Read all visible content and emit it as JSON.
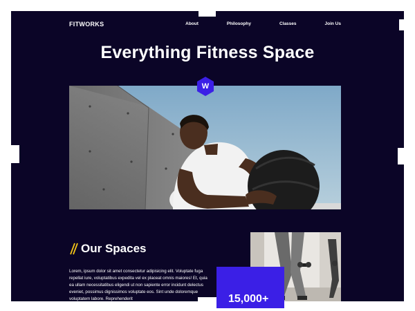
{
  "nav": {
    "logo": "FITWORKS",
    "links": [
      "About",
      "Philosophy",
      "Classes",
      "Join Us"
    ]
  },
  "hero": {
    "title": "Everything Fitness Space",
    "badge_letter": "W",
    "image_alt": "man-holding-medicine-ball"
  },
  "spaces": {
    "title": "Our Spaces",
    "body": "Lorem, ipsum dolor sit amet consectetur adipisicing elit. Voluptate fuga repellat iure, voluptatibus expedita vel ex placeat omnis maiores! Et, quia ea ullam necessitatibus eligendi ut non sapiente error incidunt delectus eveniet, possimus dignissimos voluptate eos. Sint unde doloremque voluptatem labore. Reprehenderit"
  },
  "stat": {
    "value": "15,000+"
  },
  "colors": {
    "background": "#0b0527",
    "accent": "#3b1fe6",
    "highlight": "#f5c518"
  }
}
